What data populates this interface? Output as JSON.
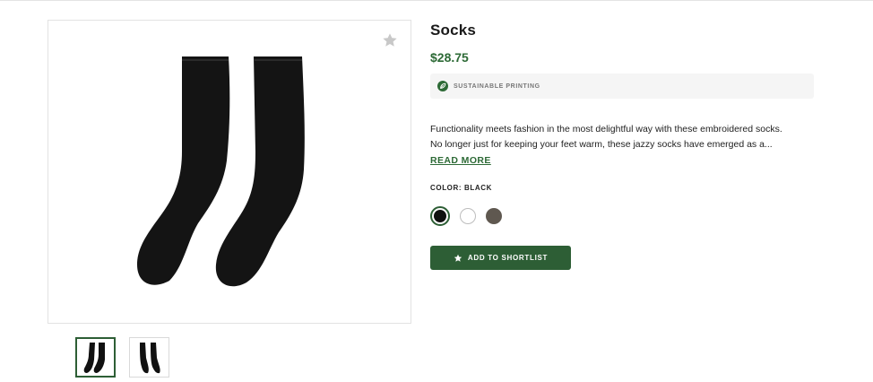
{
  "product": {
    "title": "Socks",
    "price": "$28.75",
    "badge": {
      "icon": "leaf-icon",
      "text": "SUSTAINABLE PRINTING"
    },
    "description_lines": [
      "Functionality meets fashion in the most delightful way with these embroidered socks.",
      "No longer just for keeping your feet warm, these jazzy socks have emerged as a..."
    ],
    "read_more": "READ MORE",
    "color_label": "COLOR: BLACK",
    "colors": [
      {
        "name": "black",
        "hex": "#111111",
        "selected": true
      },
      {
        "name": "white",
        "hex": "#ffffff",
        "selected": false
      },
      {
        "name": "charcoal",
        "hex": "#5f5850",
        "selected": false
      }
    ],
    "shortlist_button": {
      "icon": "star-icon",
      "label": "ADD TO SHORTLIST"
    }
  },
  "gallery": {
    "favorite_icon": "star-icon",
    "thumbnails": [
      {
        "name": "black-socks",
        "selected": true
      },
      {
        "name": "black-socks-side",
        "selected": false
      }
    ]
  },
  "colors": {
    "accent": "#2d5e35",
    "price": "#2d6a36",
    "badge_bg": "#f5f5f5"
  }
}
